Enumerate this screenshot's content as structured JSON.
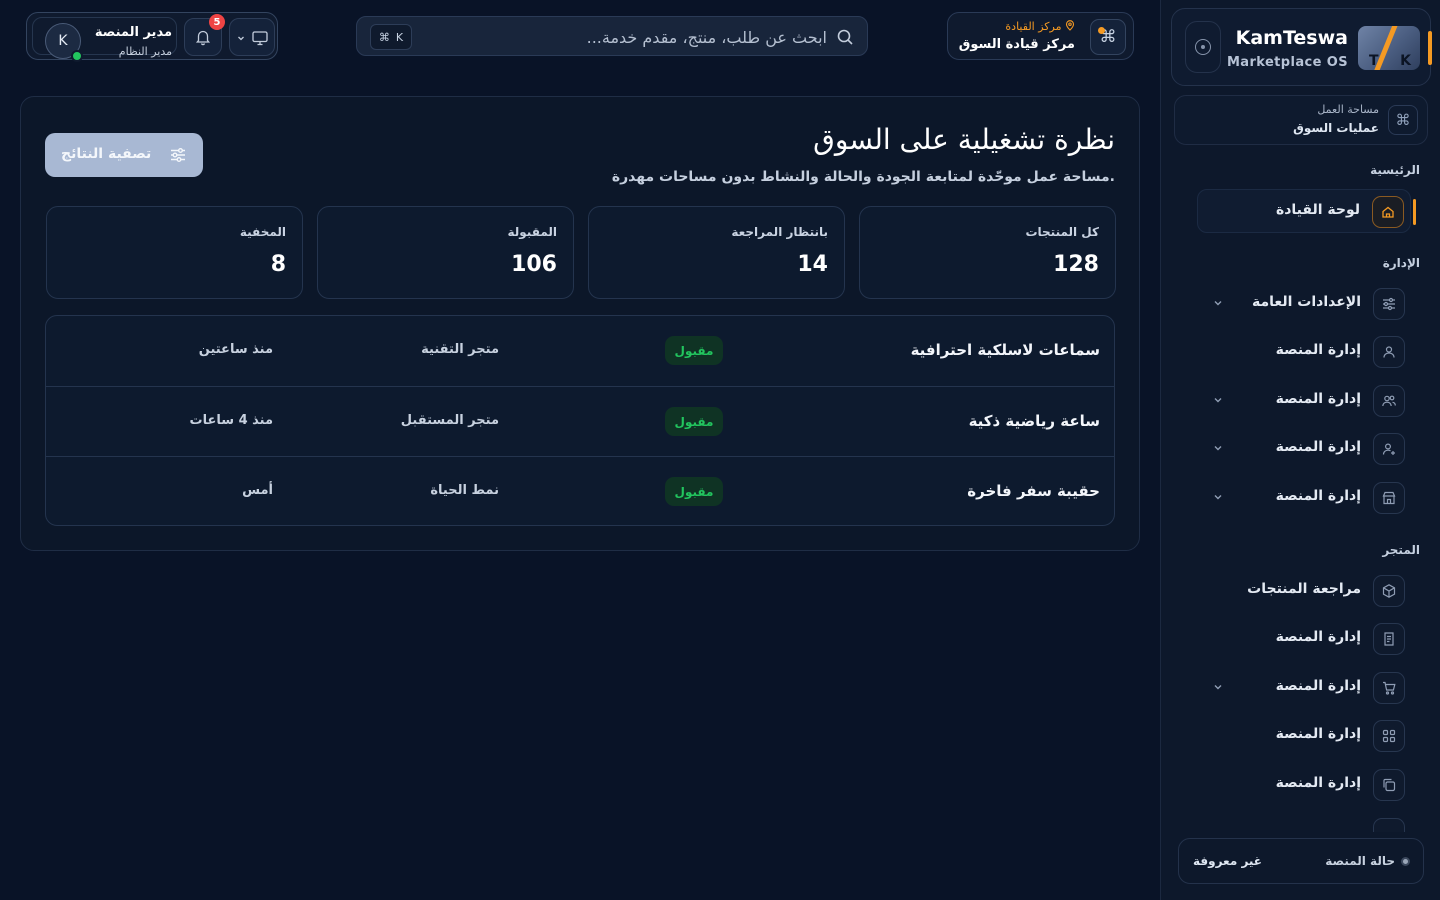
{
  "brand": {
    "name": "KamTeswa",
    "subtitle": "Marketplace OS",
    "logo_left": "T",
    "logo_right": "K"
  },
  "workspace": {
    "label": "مساحة العمل",
    "value": "عمليات السوق"
  },
  "sidebar": {
    "sections": {
      "main": "الرئيسية",
      "admin": "الإدارة",
      "store": "المتجر"
    },
    "items": [
      {
        "label": "لوحة القيادة",
        "icon": "home-icon",
        "active": true
      },
      {
        "label": "الإعدادات العامة",
        "icon": "sliders-icon",
        "chevron": true
      },
      {
        "label": "إدارة المنصة",
        "icon": "user-icon"
      },
      {
        "label": "إدارة المنصة",
        "icon": "users-icon",
        "chevron": true
      },
      {
        "label": "إدارة المنصة",
        "icon": "user-plus-icon",
        "chevron": true
      },
      {
        "label": "إدارة المنصة",
        "icon": "building-icon",
        "chevron": true
      },
      {
        "label": "مراجعة المنتجات",
        "icon": "box-icon"
      },
      {
        "label": "إدارة المنصة",
        "icon": "receipt-icon"
      },
      {
        "label": "إدارة المنصة",
        "icon": "cart-icon",
        "chevron": true
      },
      {
        "label": "إدارة المنصة",
        "icon": "grid-icon"
      },
      {
        "label": "إدارة المنصة",
        "icon": "copy-icon"
      }
    ]
  },
  "platform_status": {
    "label": "حالة المنصة",
    "value": "غير معروفة"
  },
  "header": {
    "command_center": {
      "kicker": "مركز القيادة",
      "title": "مركز قيادة السوق"
    },
    "search": {
      "placeholder": "ابحث عن طلب، منتج، مقدم خدمة...",
      "shortcut_symbol": "⌘",
      "shortcut_key": "K"
    },
    "user": {
      "name": "مدير المنصة",
      "role": "مدير النظام",
      "initial": "K"
    },
    "notifications_count": "5"
  },
  "main": {
    "title": "نظرة تشغيلية على السوق",
    "subtitle": "مساحة عمل موحّدة لمتابعة الجودة والحالة والنشاط بدون مساحات مهدرة.",
    "filter_button": "تصفية النتائج",
    "stats": [
      {
        "label": "كل المنتجات",
        "value": "128"
      },
      {
        "label": "بانتظار المراجعة",
        "value": "14"
      },
      {
        "label": "المقبولة",
        "value": "106"
      },
      {
        "label": "المخفية",
        "value": "8"
      }
    ],
    "products": [
      {
        "name": "سماعات لاسلكية احترافية",
        "status": "مقبول",
        "store": "متجر التقنية",
        "time": "منذ ساعتين"
      },
      {
        "name": "ساعة رياضية ذكية",
        "status": "مقبول",
        "store": "متجر المستقبل",
        "time": "منذ 4 ساعات"
      },
      {
        "name": "حقيبة سفر فاخرة",
        "status": "مقبول",
        "store": "نمط الحياة",
        "time": "أمس"
      }
    ]
  },
  "colors": {
    "background": "#091327",
    "accent": "#f59a23",
    "success": "#22c55e",
    "badge": "#ef4444"
  }
}
